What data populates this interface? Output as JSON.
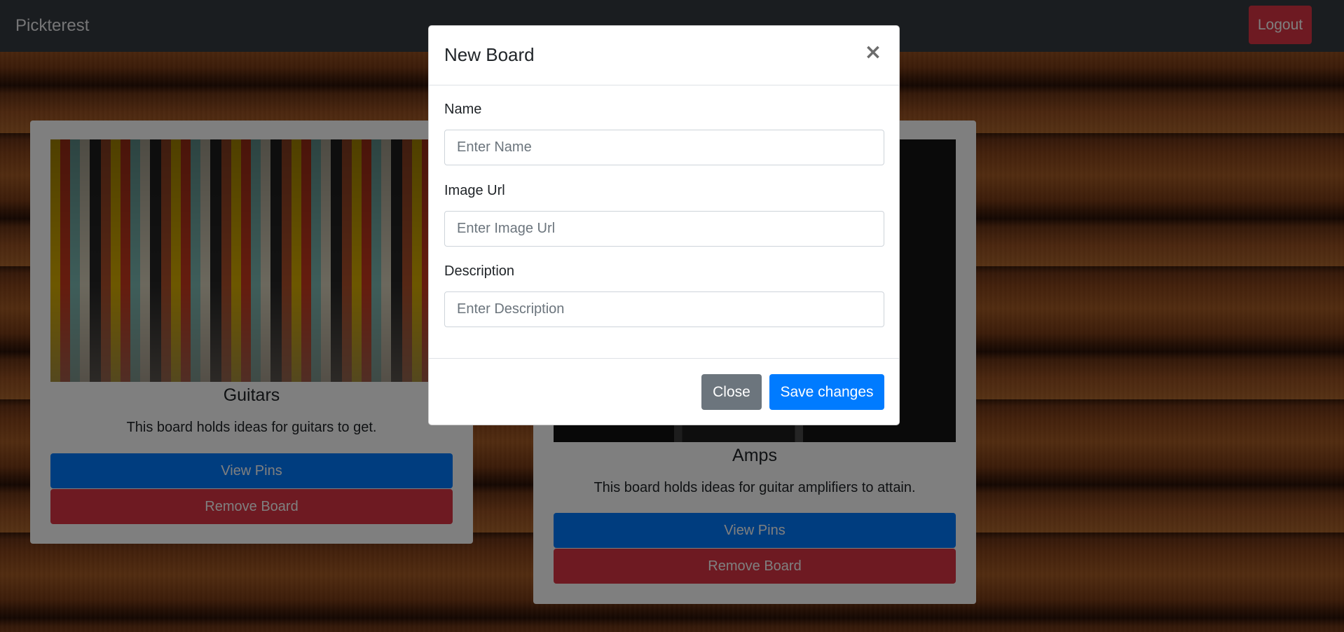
{
  "navbar": {
    "brand": "Pickterest",
    "logout_label": "Logout"
  },
  "boards": [
    {
      "title": "Guitars",
      "description": "This board holds ideas for guitars to get.",
      "view_label": "View Pins",
      "remove_label": "Remove Board"
    },
    {
      "title": "Amps",
      "description": "This board holds ideas for guitar amplifiers to attain.",
      "view_label": "View Pins",
      "remove_label": "Remove Board"
    }
  ],
  "modal": {
    "title": "New Board",
    "close_icon": "×",
    "fields": [
      {
        "label": "Name",
        "placeholder": "Enter Name",
        "value": ""
      },
      {
        "label": "Image Url",
        "placeholder": "Enter Image Url",
        "value": ""
      },
      {
        "label": "Description",
        "placeholder": "Enter Description",
        "value": ""
      }
    ],
    "close_label": "Close",
    "save_label": "Save changes"
  },
  "colors": {
    "navbar": "#343a40",
    "primary": "#007bff",
    "danger": "#dc3545",
    "secondary": "#6c757d"
  }
}
